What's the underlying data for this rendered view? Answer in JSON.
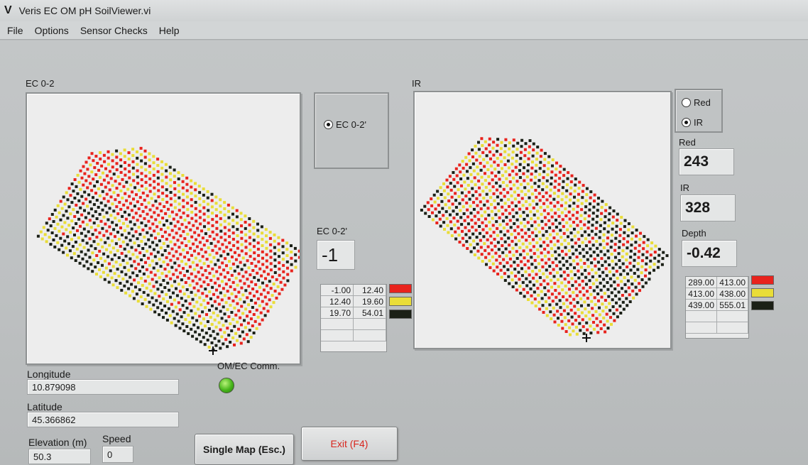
{
  "window": {
    "title": "Veris EC OM pH SoilViewer.vi",
    "icon": "V"
  },
  "menu": [
    "File",
    "Options",
    "Sensor Checks",
    "Help"
  ],
  "ec_map": {
    "label": "EC 0-2"
  },
  "ir_map": {
    "label": "IR"
  },
  "ec_select": {
    "option_label": "EC 0-2'",
    "selected": true
  },
  "ec_readout": {
    "label": "EC 0-2'",
    "value": "-1"
  },
  "ec_legend": {
    "rows": [
      {
        "min": "-1.00",
        "max": "12.40",
        "color": "#e8231d"
      },
      {
        "min": "12.40",
        "max": "19.60",
        "color": "#e9dd38"
      },
      {
        "min": "19.70",
        "max": "54.01",
        "color": "#1b2016"
      }
    ]
  },
  "ir_select": {
    "options": [
      {
        "label": "Red",
        "selected": false
      },
      {
        "label": "IR",
        "selected": true
      }
    ]
  },
  "red": {
    "label": "Red",
    "value": "243"
  },
  "ir": {
    "label": "IR",
    "value": "328"
  },
  "depth": {
    "label": "Depth",
    "value": "-0.42"
  },
  "ir_legend": {
    "rows": [
      {
        "min": "289.00",
        "max": "413.00",
        "color": "#e8231d"
      },
      {
        "min": "413.00",
        "max": "438.00",
        "color": "#e9dd38"
      },
      {
        "min": "439.00",
        "max": "555.01",
        "color": "#1b2016"
      }
    ]
  },
  "gps": {
    "longitude_label": "Longitude",
    "longitude": "10.879098",
    "latitude_label": "Latitude",
    "latitude": "45.366862",
    "elevation_label": "Elevation (m)",
    "elevation": "50.3",
    "speed_label": "Speed",
    "speed": "0"
  },
  "comm": {
    "label": "OM/EC Comm.",
    "status_color": "#46b51a"
  },
  "buttons": {
    "single_map": "Single Map (Esc.)",
    "exit": "Exit (F4)"
  }
}
